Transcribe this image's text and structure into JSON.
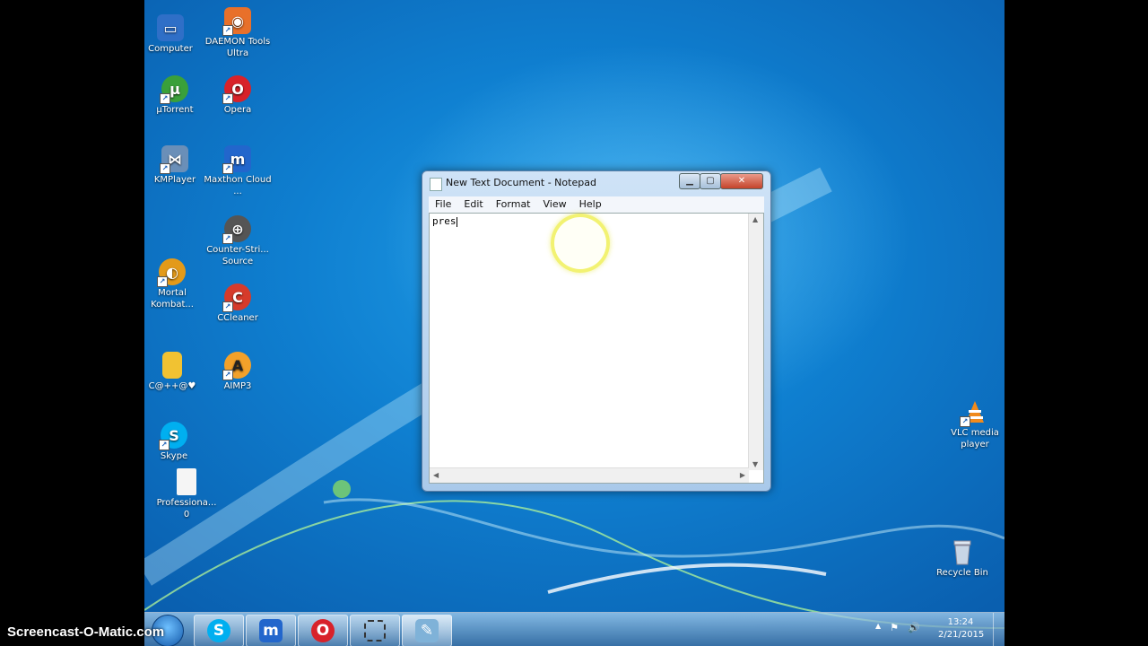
{
  "desktop": {
    "icons": [
      {
        "label": "Computer",
        "icon": "computer-icon",
        "color": "#2f6fc7"
      },
      {
        "label": "DAEMON Tools Ultra",
        "icon": "daemon-tools-icon",
        "color": "#e8702a"
      },
      {
        "label": "µTorrent",
        "icon": "utorrent-icon",
        "color": "#3aa03a"
      },
      {
        "label": "Opera",
        "icon": "opera-icon",
        "color": "#d8222a"
      },
      {
        "label": "KMPlayer",
        "icon": "kmplayer-icon",
        "color": "#6a8fb8"
      },
      {
        "label": "Maxthon Cloud ...",
        "icon": "maxthon-icon",
        "color": "#2266cc"
      },
      {
        "label": "Counter-Stri... Source",
        "icon": "counter-strike-icon",
        "color": "#555555"
      },
      {
        "label": "Mortal Kombat...",
        "icon": "mortal-kombat-icon",
        "color": "#e39a1a"
      },
      {
        "label": "CCleaner",
        "icon": "ccleaner-icon",
        "color": "#d63b2b"
      },
      {
        "label": "C@++@♥",
        "icon": "folder-icon",
        "color": "#f1c232"
      },
      {
        "label": "AIMP3",
        "icon": "aimp-icon",
        "color": "#f2a12a"
      },
      {
        "label": "Skype",
        "icon": "skype-icon",
        "color": "#00aff0"
      },
      {
        "label": "Professiona... 0",
        "icon": "document-icon",
        "color": "#f5f5f5"
      },
      {
        "label": "VLC media player",
        "icon": "vlc-icon",
        "color": "#f08a1c"
      },
      {
        "label": "Recycle Bin",
        "icon": "recycle-bin-icon",
        "color": "#c8d6e6"
      }
    ]
  },
  "notepad": {
    "title": "New Text Document - Notepad",
    "menu": [
      "File",
      "Edit",
      "Format",
      "View",
      "Help"
    ],
    "content": "pres"
  },
  "taskbar": {
    "pinned": [
      {
        "icon": "skype-icon",
        "glyph": "S",
        "color": "#00aff0"
      },
      {
        "icon": "maxthon-icon",
        "glyph": "m",
        "color": "#2266cc"
      },
      {
        "icon": "opera-icon",
        "glyph": "O",
        "color": "#d8222a"
      },
      {
        "icon": "screen-capture-icon",
        "glyph": "▢",
        "color": "#333333"
      },
      {
        "icon": "notepad-icon",
        "glyph": "✎",
        "color": "#7fb2d8"
      }
    ],
    "tray": {
      "up": "▲",
      "flag": "⚑",
      "volume": "🔊"
    },
    "time": "13:24",
    "date": "2/21/2015"
  },
  "watermark": "Screencast-O-Matic.com"
}
